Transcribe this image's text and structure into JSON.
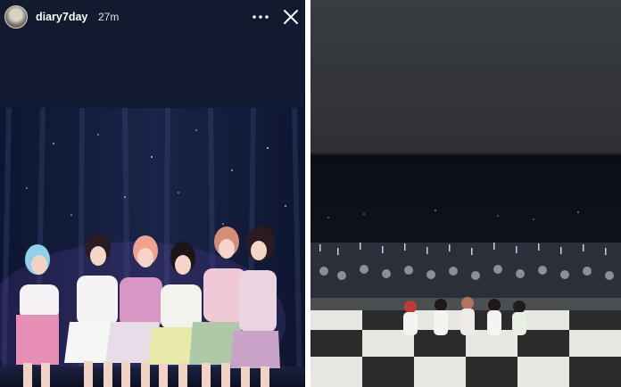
{
  "story": {
    "username": "diary7day",
    "time_ago": "27m",
    "avatar_icon": "profile-avatar",
    "more_icon": "more-horizontal-icon",
    "close_icon": "close-icon"
  },
  "colors": {
    "left_background": "#111a33",
    "right_upper_background": "#2e3033",
    "text": "#ffffff"
  }
}
